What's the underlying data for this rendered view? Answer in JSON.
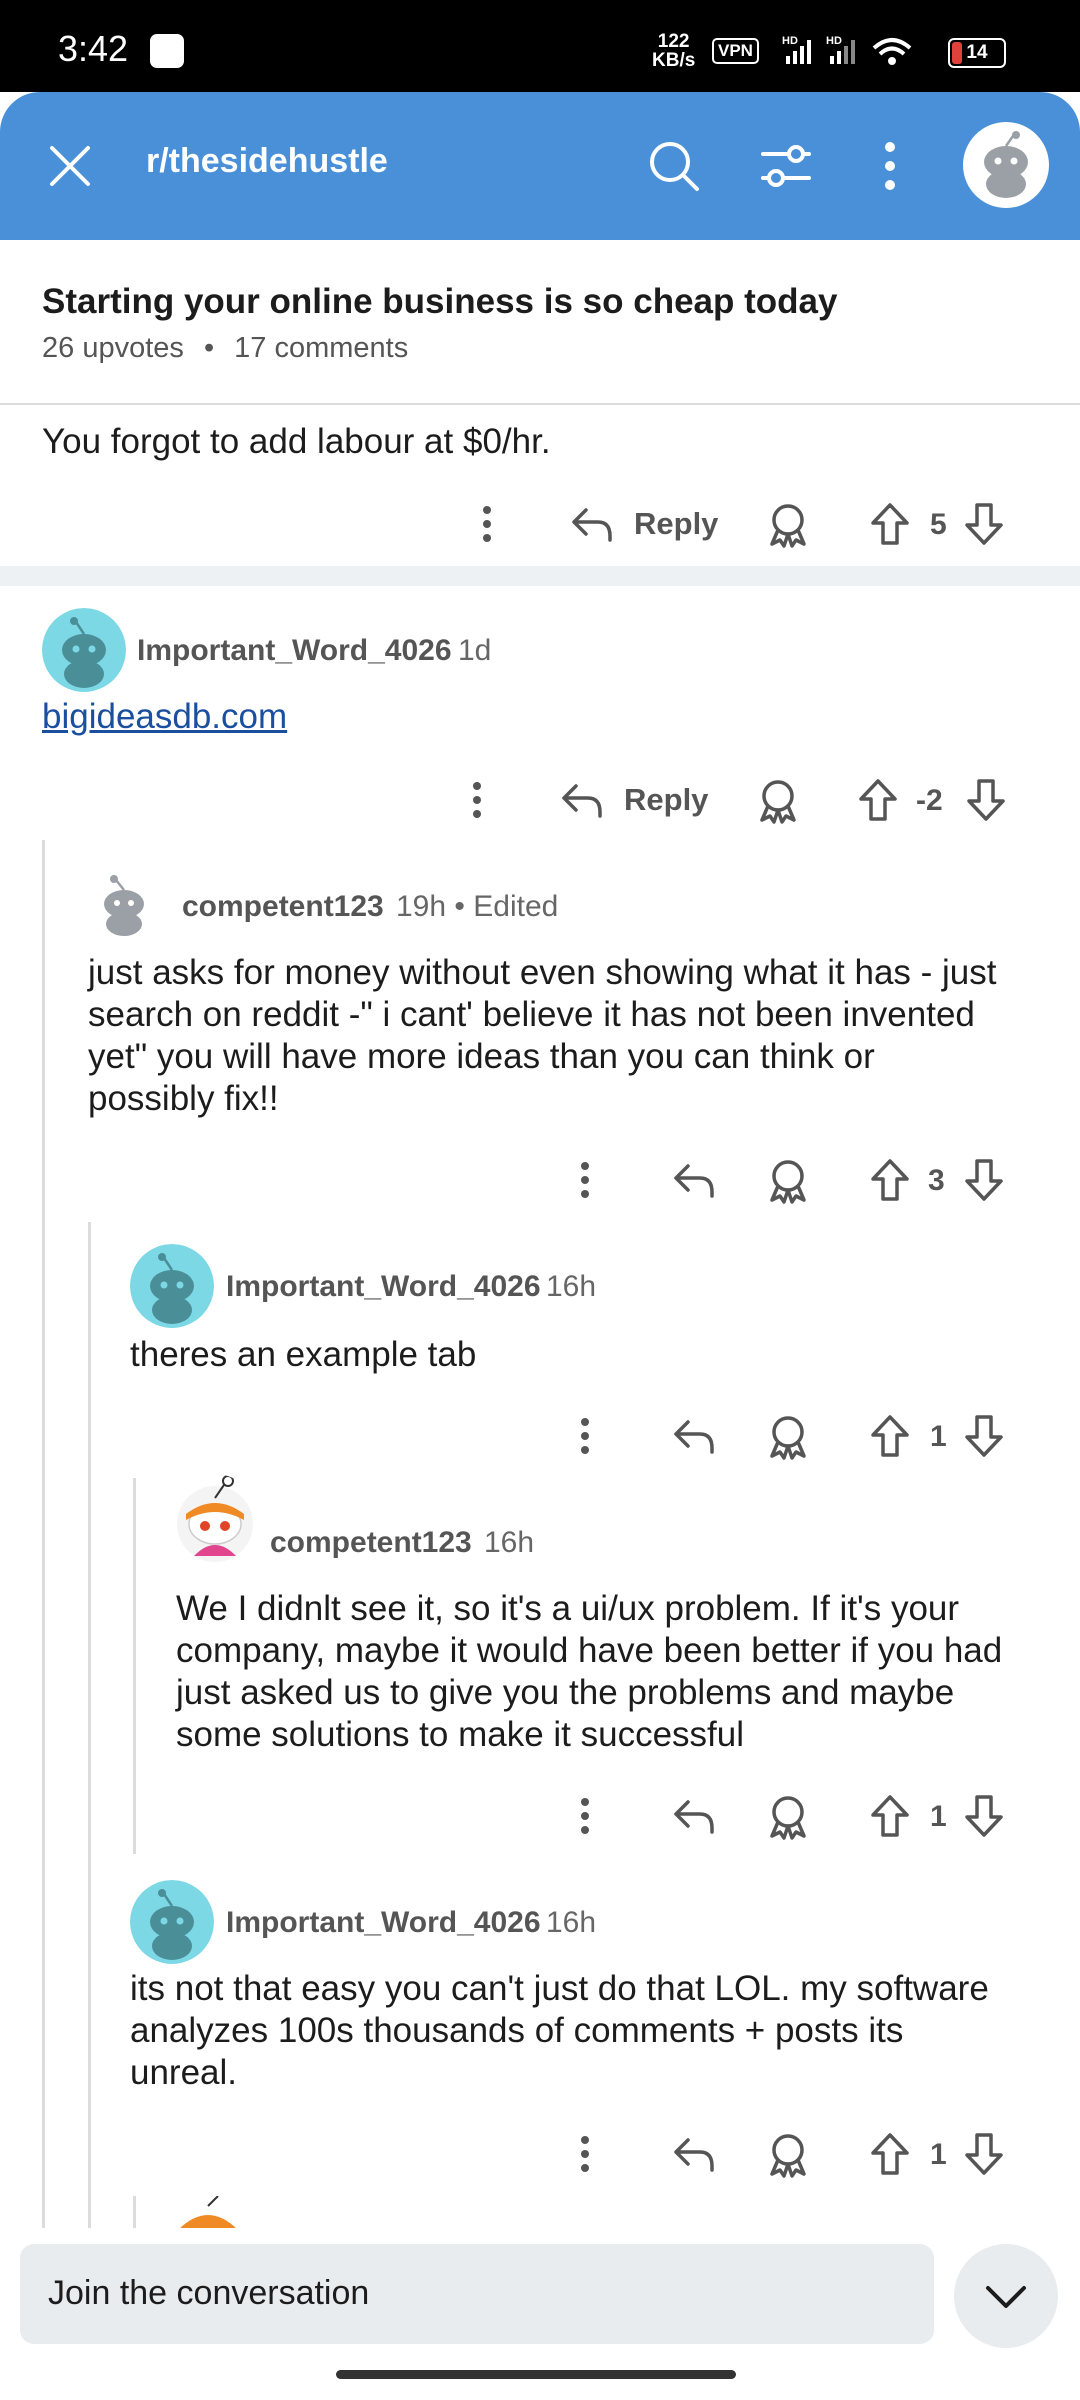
{
  "status_bar": {
    "time": "3:42",
    "net_speed_value": "122",
    "net_speed_unit": "KB/s",
    "vpn": "VPN",
    "battery": "14"
  },
  "header": {
    "subreddit": "r/thesidehustle"
  },
  "post": {
    "title": "Starting your online business is so cheap today",
    "upvotes": "26 upvotes",
    "separator": "•",
    "comments": "17 comments"
  },
  "comments": [
    {
      "text": "You forgot to add labour at $0/hr.",
      "reply_label": "Reply",
      "score": "5"
    },
    {
      "username": "Important_Word_4026",
      "age": "1d",
      "link": "bigideasdb.com",
      "reply_label": "Reply",
      "score": "-2"
    },
    {
      "username": "competent123",
      "age": "19h",
      "edited": "• Edited",
      "lines": [
        "just asks for money without even showing what it has - just",
        "search on reddit -\" i cant' believe it has not been invented",
        "yet\" you will have more ideas than you can think or",
        "possibly fix!!"
      ],
      "score": "3"
    },
    {
      "username": "Important_Word_4026",
      "age": "16h",
      "lines": [
        "theres an example tab"
      ],
      "score": "1"
    },
    {
      "username": "competent123",
      "age": "16h",
      "lines": [
        "We I didnlt see it, so it's a ui/ux problem. If it's your",
        "company, maybe it would have been better if you had",
        "just asked us to give you the problems and maybe",
        "some solutions to make it successful"
      ],
      "score": "1"
    },
    {
      "username": "Important_Word_4026",
      "age": "16h",
      "lines": [
        "its not that easy you can't just do that LOL. my software",
        "analyzes 100s thousands of comments + posts its",
        "unreal."
      ],
      "score": "1"
    }
  ],
  "composer": {
    "placeholder": "Join the conversation"
  },
  "colors": {
    "header": "#4a90d9",
    "link": "#1a4e9e",
    "snoo_teal": "#7dd8e6"
  },
  "icons": [
    "close-icon",
    "search-icon",
    "filter-icon",
    "more-vertical-icon",
    "avatar",
    "reply-icon",
    "award-icon",
    "upvote-icon",
    "downvote-icon",
    "chevron-down-icon"
  ]
}
